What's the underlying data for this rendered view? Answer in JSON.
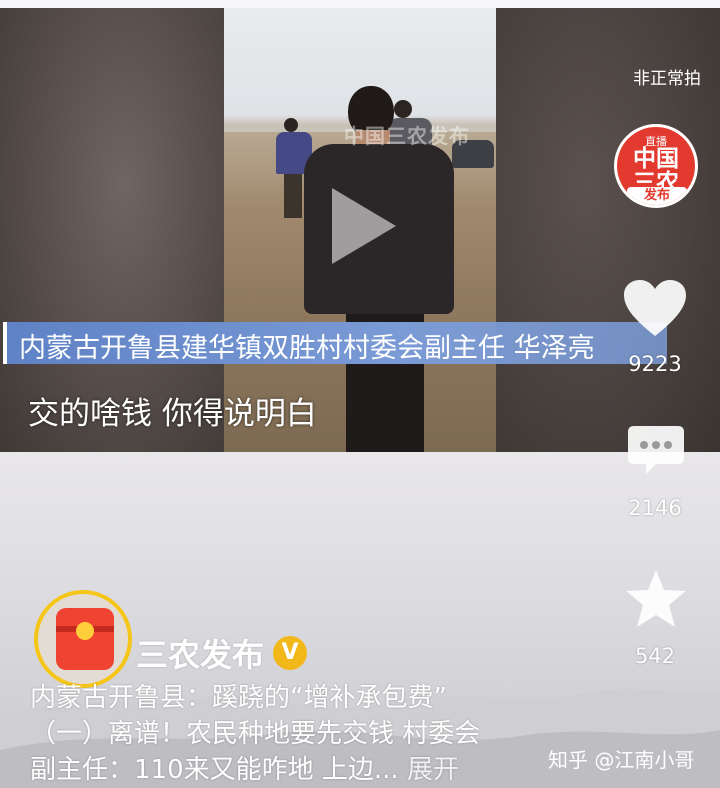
{
  "status": {
    "top_right_text": "非正常拍"
  },
  "video": {
    "watermark": "中国三农发布",
    "caption_bar": "内蒙古开鲁县建华镇双胜村村委会副主任  华泽亮",
    "subtitle": "交的啥钱  你得说明白"
  },
  "rail": {
    "channel_logo": {
      "line1": "直播",
      "line2a": "中国",
      "line2b": "三农",
      "line3": "发布"
    },
    "like_count": "9223",
    "comment_count": "2146",
    "favorite_count": "542"
  },
  "author": {
    "name": "三农发布",
    "verified_mark": "V"
  },
  "description": {
    "line1": "内蒙古开鲁县：蹊跷的“增补承包费”",
    "line2": "（一）离谱！农民种地要先交钱 村委会",
    "line3": "副主任：110来又能咋地 上边...",
    "expand": "展开"
  },
  "footer": {
    "brand": "知乎 @江南小哥"
  },
  "colors": {
    "caption_blue": "#6f8fd0",
    "logo_red": "#e23a2f",
    "verified_gold": "#f2b81a"
  }
}
